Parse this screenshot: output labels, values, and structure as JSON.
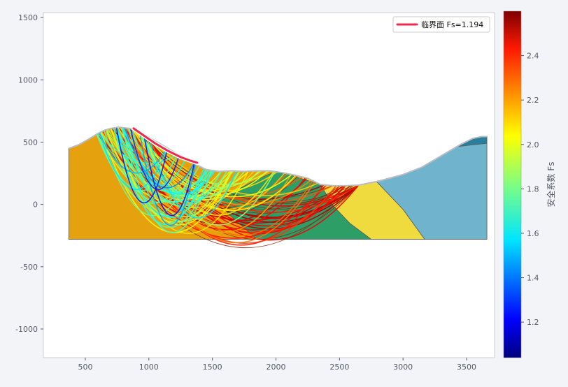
{
  "chart_data": {
    "type": "slope-stability-profile",
    "x_ticks": [
      500,
      1000,
      1500,
      2000,
      2500,
      3000,
      3500
    ],
    "y_ticks": [
      1500,
      1000,
      500,
      0,
      -500,
      -1000
    ],
    "xlim": [
      170,
      3720
    ],
    "ylim": [
      -1230,
      1540
    ],
    "legend": {
      "label": "临界面 Fs=1.194",
      "color": "#f0284a",
      "position": "top-right"
    },
    "colorbar": {
      "label": "安全系数 Fs",
      "range": [
        1.04,
        2.6
      ],
      "ticks": [
        "1.2",
        "1.4",
        "1.6",
        "1.8",
        "2.0",
        "2.2",
        "2.4"
      ],
      "tick_values": [
        1.2,
        1.4,
        1.6,
        1.8,
        2.0,
        2.2,
        2.4
      ],
      "colormap": "jet"
    },
    "ground_surface": [
      [
        370,
        450
      ],
      [
        450,
        480
      ],
      [
        520,
        520
      ],
      [
        600,
        570
      ],
      [
        650,
        595
      ],
      [
        700,
        610
      ],
      [
        760,
        620
      ],
      [
        850,
        610
      ],
      [
        950,
        570
      ],
      [
        1050,
        510
      ],
      [
        1150,
        450
      ],
      [
        1250,
        390
      ],
      [
        1350,
        330
      ],
      [
        1450,
        280
      ],
      [
        1550,
        265
      ],
      [
        1650,
        270
      ],
      [
        1750,
        265
      ],
      [
        1850,
        270
      ],
      [
        1950,
        270
      ],
      [
        2050,
        255
      ],
      [
        2150,
        235
      ],
      [
        2250,
        210
      ],
      [
        2350,
        160
      ],
      [
        2450,
        150
      ],
      [
        2550,
        150
      ],
      [
        2650,
        155
      ],
      [
        2800,
        185
      ],
      [
        3000,
        240
      ],
      [
        3150,
        300
      ],
      [
        3300,
        390
      ],
      [
        3450,
        480
      ],
      [
        3550,
        530
      ],
      [
        3620,
        545
      ],
      [
        3660,
        545
      ]
    ],
    "base_elevation": -280,
    "layers": [
      {
        "name": "layer-1",
        "color": "#e6a20e",
        "polygon": [
          [
            370,
            -280
          ],
          [
            370,
            450
          ],
          [
            450,
            480
          ],
          [
            520,
            520
          ],
          [
            600,
            570
          ],
          [
            650,
            595
          ],
          [
            700,
            610
          ],
          [
            760,
            620
          ],
          [
            850,
            610
          ],
          [
            950,
            570
          ],
          [
            1050,
            510
          ],
          [
            1150,
            450
          ],
          [
            1250,
            390
          ],
          [
            1350,
            330
          ],
          [
            1450,
            280
          ],
          [
            1550,
            265
          ],
          [
            1650,
            270
          ],
          [
            1750,
            265
          ],
          [
            1850,
            270
          ],
          [
            1950,
            270
          ],
          [
            2000,
            265
          ],
          [
            1850,
            200
          ],
          [
            1700,
            120
          ],
          [
            1560,
            40
          ],
          [
            1620,
            -70
          ],
          [
            1850,
            -280
          ]
        ]
      },
      {
        "name": "layer-2",
        "color": "#2e9e67",
        "polygon": [
          [
            1560,
            40
          ],
          [
            1700,
            120
          ],
          [
            1850,
            200
          ],
          [
            2000,
            265
          ],
          [
            2050,
            255
          ],
          [
            2150,
            235
          ],
          [
            2250,
            210
          ],
          [
            2350,
            160
          ],
          [
            2450,
            -10
          ],
          [
            2580,
            -150
          ],
          [
            2750,
            -280
          ],
          [
            1850,
            -280
          ],
          [
            1620,
            -70
          ]
        ]
      },
      {
        "name": "layer-3",
        "color": "#f0db3f",
        "polygon": [
          [
            2050,
            255
          ],
          [
            2150,
            235
          ],
          [
            2250,
            210
          ],
          [
            2350,
            160
          ],
          [
            2450,
            150
          ],
          [
            2550,
            150
          ],
          [
            2650,
            155
          ],
          [
            2790,
            185
          ],
          [
            3000,
            -40
          ],
          [
            3170,
            -280
          ],
          [
            2750,
            -280
          ],
          [
            2580,
            -150
          ],
          [
            2450,
            -10
          ],
          [
            2350,
            160
          ]
        ]
      },
      {
        "name": "layer-4",
        "color": "#70b3cc",
        "polygon": [
          [
            2790,
            185
          ],
          [
            3000,
            240
          ],
          [
            3150,
            300
          ],
          [
            3300,
            390
          ],
          [
            3450,
            480
          ],
          [
            3550,
            530
          ],
          [
            3620,
            545
          ],
          [
            3660,
            545
          ],
          [
            3660,
            -280
          ],
          [
            3170,
            -280
          ],
          [
            3000,
            -40
          ]
        ]
      },
      {
        "name": "layer-5",
        "color": "#2b7f9e",
        "polygon": [
          [
            3420,
            465
          ],
          [
            3500,
            505
          ],
          [
            3580,
            535
          ],
          [
            3660,
            548
          ],
          [
            3660,
            490
          ],
          [
            3560,
            480
          ],
          [
            3480,
            470
          ]
        ]
      }
    ],
    "critical_surface": {
      "fs": 1.194,
      "color": "#f0284a",
      "points": [
        [
          880,
          610
        ],
        [
          950,
          560
        ],
        [
          1050,
          490
        ],
        [
          1150,
          430
        ],
        [
          1250,
          380
        ],
        [
          1330,
          350
        ],
        [
          1380,
          335
        ]
      ]
    },
    "surfaces": {
      "count": 90,
      "fs_min": 1.194,
      "fs_max": 2.55,
      "x_start_range": [
        570,
        1000
      ],
      "x_end_range": [
        1330,
        2650
      ]
    }
  }
}
